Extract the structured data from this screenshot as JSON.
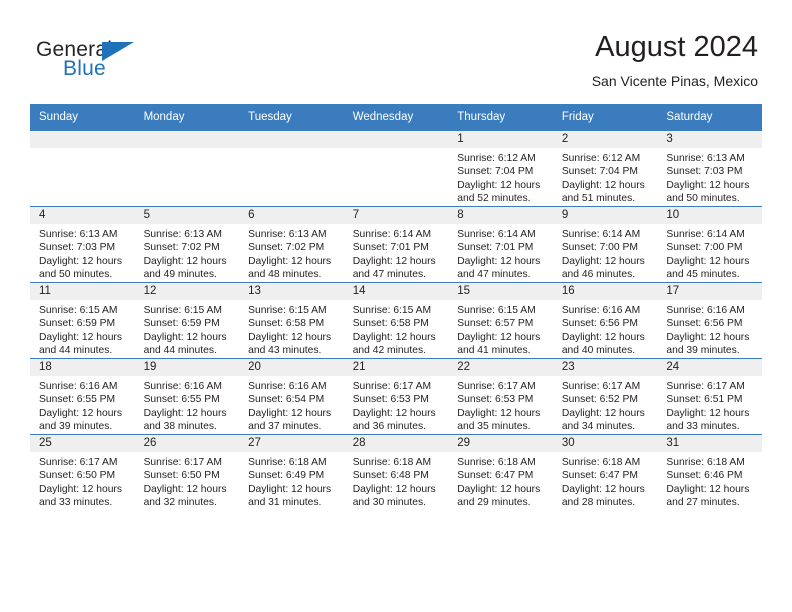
{
  "brand": {
    "name_part1": "General",
    "name_part2": "Blue",
    "logo_color": "#1f72b8",
    "text_color": "#262626"
  },
  "header": {
    "title": "August 2024",
    "subtitle": "San Vicente Pinas, Mexico"
  },
  "theme": {
    "header_blue": "#3a7cbe",
    "daynum_gray": "#efefef",
    "text": "#231f20"
  },
  "weekday_headers": [
    "Sunday",
    "Monday",
    "Tuesday",
    "Wednesday",
    "Thursday",
    "Friday",
    "Saturday"
  ],
  "labels": {
    "sunrise": "Sunrise:",
    "sunset": "Sunset:",
    "daylight": "Daylight:"
  },
  "weeks": [
    [
      {
        "day": "",
        "empty": true
      },
      {
        "day": "",
        "empty": true
      },
      {
        "day": "",
        "empty": true
      },
      {
        "day": "",
        "empty": true
      },
      {
        "day": "1",
        "sunrise": "Sunrise: 6:12 AM",
        "sunset": "Sunset: 7:04 PM",
        "daylight_1": "Daylight: 12 hours",
        "daylight_2": "and 52 minutes."
      },
      {
        "day": "2",
        "sunrise": "Sunrise: 6:12 AM",
        "sunset": "Sunset: 7:04 PM",
        "daylight_1": "Daylight: 12 hours",
        "daylight_2": "and 51 minutes."
      },
      {
        "day": "3",
        "sunrise": "Sunrise: 6:13 AM",
        "sunset": "Sunset: 7:03 PM",
        "daylight_1": "Daylight: 12 hours",
        "daylight_2": "and 50 minutes."
      }
    ],
    [
      {
        "day": "4",
        "sunrise": "Sunrise: 6:13 AM",
        "sunset": "Sunset: 7:03 PM",
        "daylight_1": "Daylight: 12 hours",
        "daylight_2": "and 50 minutes."
      },
      {
        "day": "5",
        "sunrise": "Sunrise: 6:13 AM",
        "sunset": "Sunset: 7:02 PM",
        "daylight_1": "Daylight: 12 hours",
        "daylight_2": "and 49 minutes."
      },
      {
        "day": "6",
        "sunrise": "Sunrise: 6:13 AM",
        "sunset": "Sunset: 7:02 PM",
        "daylight_1": "Daylight: 12 hours",
        "daylight_2": "and 48 minutes."
      },
      {
        "day": "7",
        "sunrise": "Sunrise: 6:14 AM",
        "sunset": "Sunset: 7:01 PM",
        "daylight_1": "Daylight: 12 hours",
        "daylight_2": "and 47 minutes."
      },
      {
        "day": "8",
        "sunrise": "Sunrise: 6:14 AM",
        "sunset": "Sunset: 7:01 PM",
        "daylight_1": "Daylight: 12 hours",
        "daylight_2": "and 47 minutes."
      },
      {
        "day": "9",
        "sunrise": "Sunrise: 6:14 AM",
        "sunset": "Sunset: 7:00 PM",
        "daylight_1": "Daylight: 12 hours",
        "daylight_2": "and 46 minutes."
      },
      {
        "day": "10",
        "sunrise": "Sunrise: 6:14 AM",
        "sunset": "Sunset: 7:00 PM",
        "daylight_1": "Daylight: 12 hours",
        "daylight_2": "and 45 minutes."
      }
    ],
    [
      {
        "day": "11",
        "sunrise": "Sunrise: 6:15 AM",
        "sunset": "Sunset: 6:59 PM",
        "daylight_1": "Daylight: 12 hours",
        "daylight_2": "and 44 minutes."
      },
      {
        "day": "12",
        "sunrise": "Sunrise: 6:15 AM",
        "sunset": "Sunset: 6:59 PM",
        "daylight_1": "Daylight: 12 hours",
        "daylight_2": "and 44 minutes."
      },
      {
        "day": "13",
        "sunrise": "Sunrise: 6:15 AM",
        "sunset": "Sunset: 6:58 PM",
        "daylight_1": "Daylight: 12 hours",
        "daylight_2": "and 43 minutes."
      },
      {
        "day": "14",
        "sunrise": "Sunrise: 6:15 AM",
        "sunset": "Sunset: 6:58 PM",
        "daylight_1": "Daylight: 12 hours",
        "daylight_2": "and 42 minutes."
      },
      {
        "day": "15",
        "sunrise": "Sunrise: 6:15 AM",
        "sunset": "Sunset: 6:57 PM",
        "daylight_1": "Daylight: 12 hours",
        "daylight_2": "and 41 minutes."
      },
      {
        "day": "16",
        "sunrise": "Sunrise: 6:16 AM",
        "sunset": "Sunset: 6:56 PM",
        "daylight_1": "Daylight: 12 hours",
        "daylight_2": "and 40 minutes."
      },
      {
        "day": "17",
        "sunrise": "Sunrise: 6:16 AM",
        "sunset": "Sunset: 6:56 PM",
        "daylight_1": "Daylight: 12 hours",
        "daylight_2": "and 39 minutes."
      }
    ],
    [
      {
        "day": "18",
        "sunrise": "Sunrise: 6:16 AM",
        "sunset": "Sunset: 6:55 PM",
        "daylight_1": "Daylight: 12 hours",
        "daylight_2": "and 39 minutes."
      },
      {
        "day": "19",
        "sunrise": "Sunrise: 6:16 AM",
        "sunset": "Sunset: 6:55 PM",
        "daylight_1": "Daylight: 12 hours",
        "daylight_2": "and 38 minutes."
      },
      {
        "day": "20",
        "sunrise": "Sunrise: 6:16 AM",
        "sunset": "Sunset: 6:54 PM",
        "daylight_1": "Daylight: 12 hours",
        "daylight_2": "and 37 minutes."
      },
      {
        "day": "21",
        "sunrise": "Sunrise: 6:17 AM",
        "sunset": "Sunset: 6:53 PM",
        "daylight_1": "Daylight: 12 hours",
        "daylight_2": "and 36 minutes."
      },
      {
        "day": "22",
        "sunrise": "Sunrise: 6:17 AM",
        "sunset": "Sunset: 6:53 PM",
        "daylight_1": "Daylight: 12 hours",
        "daylight_2": "and 35 minutes."
      },
      {
        "day": "23",
        "sunrise": "Sunrise: 6:17 AM",
        "sunset": "Sunset: 6:52 PM",
        "daylight_1": "Daylight: 12 hours",
        "daylight_2": "and 34 minutes."
      },
      {
        "day": "24",
        "sunrise": "Sunrise: 6:17 AM",
        "sunset": "Sunset: 6:51 PM",
        "daylight_1": "Daylight: 12 hours",
        "daylight_2": "and 33 minutes."
      }
    ],
    [
      {
        "day": "25",
        "sunrise": "Sunrise: 6:17 AM",
        "sunset": "Sunset: 6:50 PM",
        "daylight_1": "Daylight: 12 hours",
        "daylight_2": "and 33 minutes."
      },
      {
        "day": "26",
        "sunrise": "Sunrise: 6:17 AM",
        "sunset": "Sunset: 6:50 PM",
        "daylight_1": "Daylight: 12 hours",
        "daylight_2": "and 32 minutes."
      },
      {
        "day": "27",
        "sunrise": "Sunrise: 6:18 AM",
        "sunset": "Sunset: 6:49 PM",
        "daylight_1": "Daylight: 12 hours",
        "daylight_2": "and 31 minutes."
      },
      {
        "day": "28",
        "sunrise": "Sunrise: 6:18 AM",
        "sunset": "Sunset: 6:48 PM",
        "daylight_1": "Daylight: 12 hours",
        "daylight_2": "and 30 minutes."
      },
      {
        "day": "29",
        "sunrise": "Sunrise: 6:18 AM",
        "sunset": "Sunset: 6:47 PM",
        "daylight_1": "Daylight: 12 hours",
        "daylight_2": "and 29 minutes."
      },
      {
        "day": "30",
        "sunrise": "Sunrise: 6:18 AM",
        "sunset": "Sunset: 6:47 PM",
        "daylight_1": "Daylight: 12 hours",
        "daylight_2": "and 28 minutes."
      },
      {
        "day": "31",
        "sunrise": "Sunrise: 6:18 AM",
        "sunset": "Sunset: 6:46 PM",
        "daylight_1": "Daylight: 12 hours",
        "daylight_2": "and 27 minutes."
      }
    ]
  ]
}
